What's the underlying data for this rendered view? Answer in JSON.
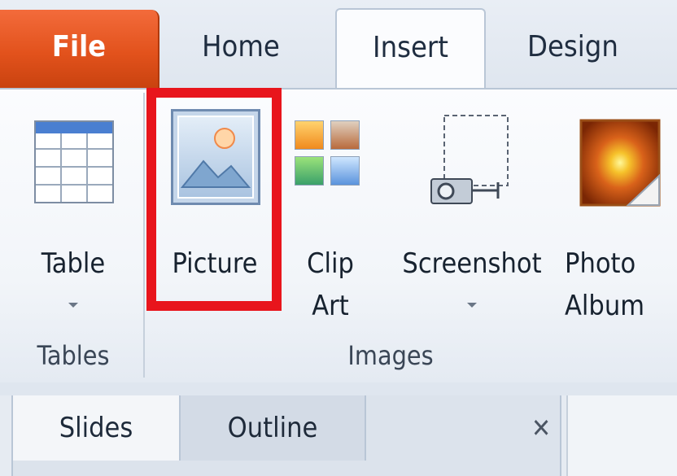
{
  "tabs": {
    "file": "File",
    "home": "Home",
    "insert": "Insert",
    "design": "Design"
  },
  "ribbon": {
    "tables_group": {
      "label": "Tables",
      "table_button": "Table"
    },
    "images_group": {
      "label": "Images",
      "picture_button": "Picture",
      "clip_art_line1": "Clip",
      "clip_art_line2": "Art",
      "screenshot_button": "Screenshot",
      "photo_album_line1": "Photo",
      "photo_album_line2": "Album"
    }
  },
  "pane": {
    "slides_tab": "Slides",
    "outline_tab": "Outline",
    "close_glyph": "✕"
  },
  "colors": {
    "file_tab": "#e2521c",
    "highlight": "#e8151c",
    "ribbon_bg": "#f7f9fc"
  },
  "icons": [
    "table-icon",
    "picture-icon",
    "clip-art-icon",
    "screenshot-icon",
    "photo-album-icon",
    "close-icon"
  ]
}
